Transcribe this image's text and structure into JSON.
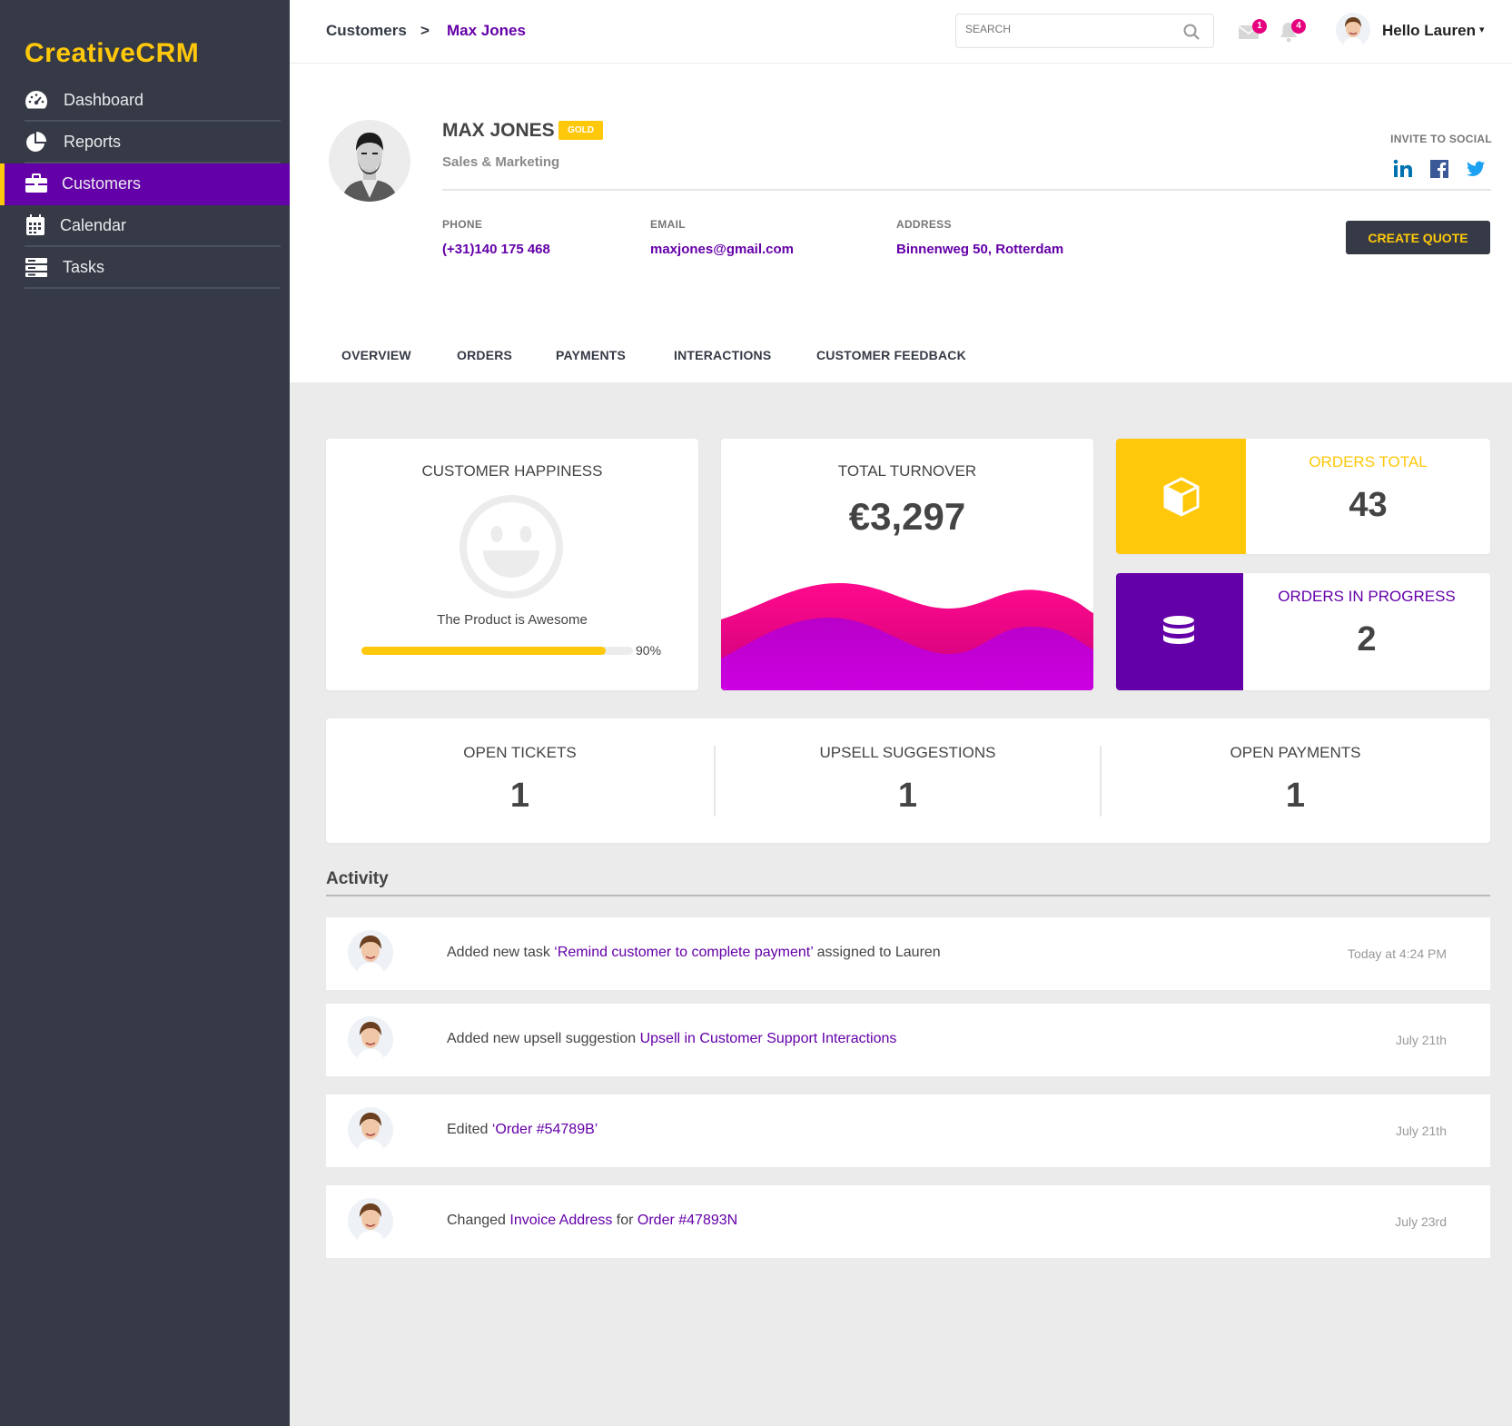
{
  "app": {
    "logo": "CreativeCRM"
  },
  "sidebar": {
    "items": [
      {
        "label": "Dashboard",
        "icon": "dashboard-gauge-icon"
      },
      {
        "label": "Reports",
        "icon": "pie-chart-icon"
      },
      {
        "label": "Customers",
        "icon": "briefcase-icon",
        "active": true
      },
      {
        "label": "Calendar",
        "icon": "calendar-icon"
      },
      {
        "label": "Tasks",
        "icon": "server-stack-icon"
      }
    ]
  },
  "topbar": {
    "breadcrumb": [
      "Customers",
      ">",
      "Max Jones"
    ],
    "search_placeholder": "SEARCH",
    "mail_count": "1",
    "notification_count": "4",
    "greeting": "Hello Lauren",
    "caret": "▾"
  },
  "profile": {
    "name": "MAX JONES",
    "badge": "GOLD",
    "role": "Sales & Marketing",
    "invite_label": "INVITE TO SOCIAL",
    "social": [
      "linkedin-icon",
      "facebook-icon",
      "twitter-icon"
    ],
    "fields": [
      {
        "label": "PHONE",
        "value": "(+31)140 175 468"
      },
      {
        "label": "EMAIL",
        "value": "maxjones@gmail.com"
      },
      {
        "label": "ADDRESS",
        "value": "Binnenweg 50, Rotterdam"
      }
    ],
    "create_quote": "CREATE QUOTE"
  },
  "tabs": [
    "OVERVIEW",
    "ORDERS",
    "PAYMENTS",
    "INTERACTIONS",
    "CUSTOMER FEEDBACK"
  ],
  "cards": {
    "happiness": {
      "title": "CUSTOMER HAPPINESS",
      "caption": "The Product is Awesome",
      "percent_label": "90%",
      "percent": 0.9
    },
    "turnover": {
      "title": "TOTAL TURNOVER",
      "value": "€3,297"
    },
    "orders_total": {
      "title": "ORDERS TOTAL",
      "value": "43"
    },
    "orders_progress": {
      "title": "ORDERS IN PROGRESS",
      "value": "2"
    }
  },
  "stats": [
    {
      "label": "OPEN TICKETS",
      "value": "1"
    },
    {
      "label": "UPSELL SUGGESTIONS",
      "value": "1"
    },
    {
      "label": "OPEN PAYMENTS",
      "value": "1"
    }
  ],
  "activity": {
    "title": "Activity",
    "items": [
      {
        "pre": "Added new task ",
        "link1": "‘Remind customer to complete payment’",
        "mid": " assigned to Lauren",
        "link2": "",
        "time": "Today at 4:24 PM"
      },
      {
        "pre": "Added new upsell suggestion ",
        "link1": "Upsell in Customer Support Interactions",
        "mid": "",
        "link2": "",
        "time": "July 21th"
      },
      {
        "pre": "Edited ",
        "link1": "‘Order #54789B’",
        "mid": "",
        "link2": "",
        "time": "July 21th"
      },
      {
        "pre": "Changed ",
        "link1": "Invoice Address",
        "mid": " for ",
        "link2": "Order #47893N",
        "time": "July 23rd"
      }
    ]
  },
  "colors": {
    "sidebar": "#353a46",
    "accent_purple": "#6400a8",
    "accent_yellow": "#ffc80a",
    "badge_pink": "#e6007e",
    "wave_magenta": "#e6007e",
    "wave_purple": "#c800d8"
  }
}
